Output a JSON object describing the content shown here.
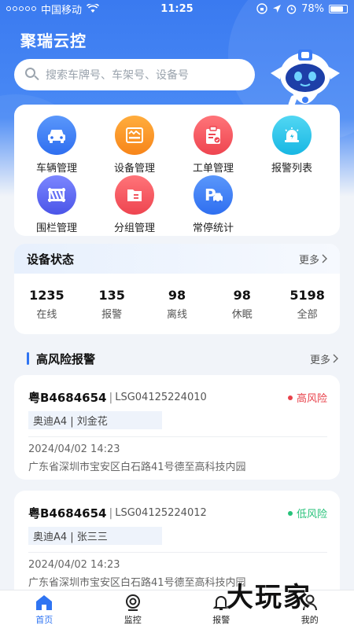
{
  "statusbar": {
    "carrier": "中国移动",
    "time": "11:25",
    "battery": "78%",
    "battery_level": 0.78
  },
  "app": {
    "title": "聚瑞云控"
  },
  "search": {
    "placeholder": "搜索车牌号、车架号、设备号"
  },
  "menu": {
    "items": [
      {
        "label": "车辆管理",
        "icon": "car-icon",
        "color": "#3b7cf5"
      },
      {
        "label": "设备管理",
        "icon": "device-icon",
        "color": "#f7921e"
      },
      {
        "label": "工单管理",
        "icon": "clipboard-icon",
        "color": "#f2545b"
      },
      {
        "label": "报警列表",
        "icon": "alarm-icon",
        "color": "#25c3e8"
      },
      {
        "label": "围栏管理",
        "icon": "fence-icon",
        "color": "#5966f0"
      },
      {
        "label": "分组管理",
        "icon": "folder-icon",
        "color": "#f2545b"
      },
      {
        "label": "常停统计",
        "icon": "parking-icon",
        "color": "#3b7cf5"
      }
    ]
  },
  "device_status": {
    "title": "设备状态",
    "more": "更多",
    "stats": [
      {
        "value": "1235",
        "label": "在线"
      },
      {
        "value": "135",
        "label": "报警"
      },
      {
        "value": "98",
        "label": "离线"
      },
      {
        "value": "98",
        "label": "休眠"
      },
      {
        "value": "5198",
        "label": "全部"
      }
    ]
  },
  "high_risk": {
    "title": "高风险报警",
    "more": "更多",
    "alarms": [
      {
        "plate": "粤B4684654",
        "vin": "LSG04125224010",
        "risk": "高风险",
        "risk_color": "#e8414a",
        "vehicle": "奥迪A4 | 刘金花",
        "time": "2024/04/02 14:23",
        "address": "广东省深圳市宝安区白石路41号德至高科技内园"
      },
      {
        "plate": "粤B4684654",
        "vin": "LSG04125224012",
        "risk": "低风险",
        "risk_color": "#27c27a",
        "vehicle": "奥迪A4 | 张三三",
        "time": "2024/04/02 14:23",
        "address": "广东省深圳市宝安区白石路41号德至高科技内园"
      }
    ]
  },
  "tabbar": {
    "tabs": [
      {
        "label": "首页",
        "icon": "home-icon",
        "active": true
      },
      {
        "label": "监控",
        "icon": "camera-icon",
        "active": false
      },
      {
        "label": "报警",
        "icon": "bell-icon",
        "active": false
      },
      {
        "label": "我的",
        "icon": "user-icon",
        "active": false
      }
    ]
  },
  "watermark": {
    "text": "大玩家"
  }
}
